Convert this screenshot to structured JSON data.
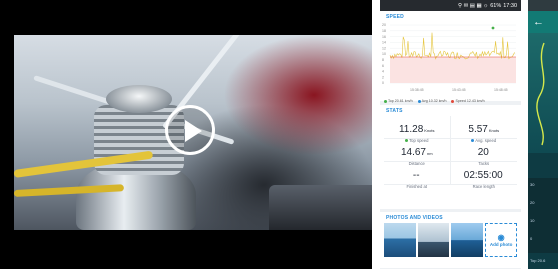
{
  "video": {
    "play_icon": "play-icon"
  },
  "phone": {
    "status_bar": {
      "icons": "⚲ ✉ ▤ ▦ ☼",
      "battery": "61%",
      "time": "17:30"
    },
    "speed": {
      "title": "SPEED",
      "y_ticks": [
        "20",
        "18",
        "16",
        "14",
        "12",
        "10",
        "8",
        "6",
        "4",
        "2",
        "0"
      ],
      "x_ticks": [
        "15:38:45",
        "15:43:45",
        "15:48:45"
      ],
      "legend": {
        "top": "Top 20.61 km/h",
        "avg": "Avg 10.32 km/h",
        "speed": "Speed 12.43 km/h"
      }
    },
    "stats": {
      "title": "STATS",
      "items": [
        {
          "value": "11.28",
          "unit": "Knots",
          "label": "Top speed",
          "dot_color": "#46b04a"
        },
        {
          "value": "5.57",
          "unit": "Knots",
          "label": "Avg. speed",
          "dot_color": "#2a8bd6"
        },
        {
          "value": "14.67",
          "unit": "nm",
          "label": "Distance",
          "dot_color": ""
        },
        {
          "value": "20",
          "unit": "",
          "label": "Tacks",
          "dot_color": ""
        },
        {
          "value": "--",
          "unit": "",
          "label": "Finished at",
          "dot_color": ""
        },
        {
          "value": "02:55:00",
          "unit": "",
          "label": "Race length",
          "dot_color": ""
        }
      ]
    },
    "photos": {
      "title": "PHOTOS AND VIDEOS",
      "add_label": "Add photo"
    }
  },
  "phone2": {
    "back_icon": "←",
    "labels": [
      "30",
      "20",
      "10",
      "0",
      "Top 20.6"
    ]
  },
  "colors": {
    "accent": "#2a8bd6",
    "top_speed": "#46b04a",
    "avg_speed": "#2a8bd6",
    "speed_line": "#e04a3c",
    "chart_line": "#e5c53c"
  }
}
